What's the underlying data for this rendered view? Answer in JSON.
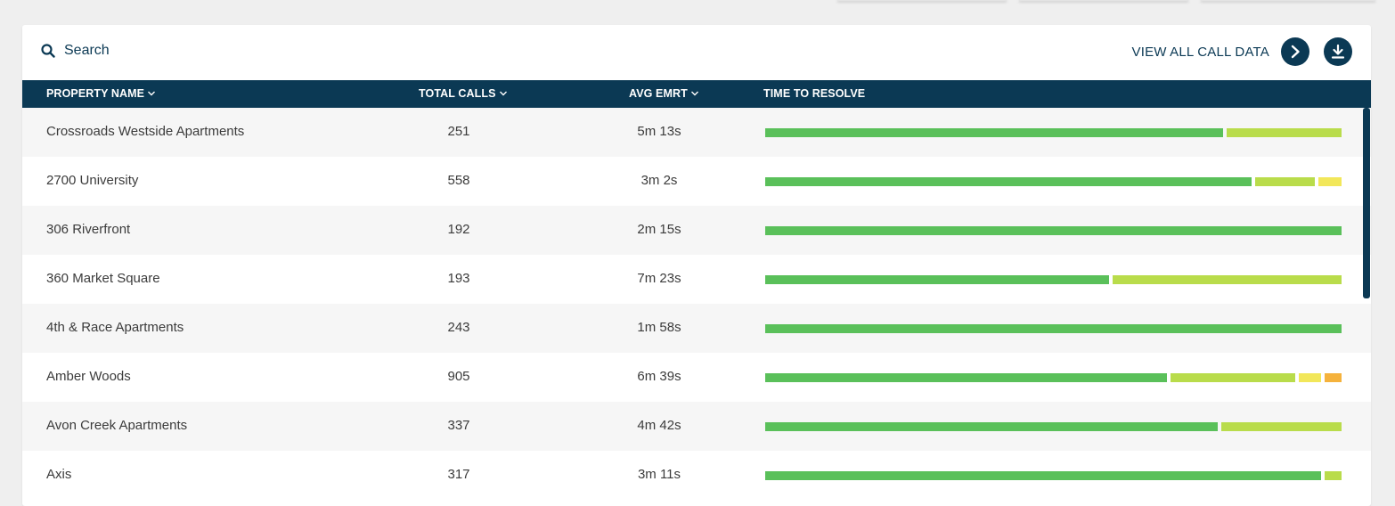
{
  "toolbar": {
    "search_label": "Search",
    "view_all_label": "VIEW ALL CALL DATA"
  },
  "table": {
    "columns": {
      "property_name": "PROPERTY NAME",
      "total_calls": "TOTAL CALLS",
      "avg_emrt": "AVG EMRT",
      "time_to_resolve": "TIME TO RESOLVE"
    },
    "rows": [
      {
        "name": "Crossroads Westside Apartments",
        "total_calls": "251",
        "avg_emrt": "5m 13s",
        "resolve": [
          {
            "color": "#5ac05a",
            "fraction": 0.8
          },
          {
            "color": "#b9dc4b",
            "fraction": 0.2
          }
        ]
      },
      {
        "name": "2700 University",
        "total_calls": "558",
        "avg_emrt": "3m 2s",
        "resolve": [
          {
            "color": "#5ac05a",
            "fraction": 0.855
          },
          {
            "color": "#b9dc4b",
            "fraction": 0.105
          },
          {
            "color": "#f2e75a",
            "fraction": 0.04
          }
        ]
      },
      {
        "name": "306 Riverfront",
        "total_calls": "192",
        "avg_emrt": "2m 15s",
        "resolve": [
          {
            "color": "#5ac05a",
            "fraction": 1.0
          }
        ]
      },
      {
        "name": "360 Market Square",
        "total_calls": "193",
        "avg_emrt": "7m 23s",
        "resolve": [
          {
            "color": "#5ac05a",
            "fraction": 0.6
          },
          {
            "color": "#b9dc4b",
            "fraction": 0.4
          }
        ]
      },
      {
        "name": "4th & Race Apartments",
        "total_calls": "243",
        "avg_emrt": "1m 58s",
        "resolve": [
          {
            "color": "#5ac05a",
            "fraction": 1.0
          }
        ]
      },
      {
        "name": "Amber Woods",
        "total_calls": "905",
        "avg_emrt": "6m 39s",
        "resolve": [
          {
            "color": "#5ac05a",
            "fraction": 0.71
          },
          {
            "color": "#b9dc4b",
            "fraction": 0.22
          },
          {
            "color": "#f2e75a",
            "fraction": 0.04
          },
          {
            "color": "#f5b23c",
            "fraction": 0.03
          }
        ]
      },
      {
        "name": "Avon Creek Apartments",
        "total_calls": "337",
        "avg_emrt": "4m 42s",
        "resolve": [
          {
            "color": "#5ac05a",
            "fraction": 0.79
          },
          {
            "color": "#b9dc4b",
            "fraction": 0.21
          }
        ]
      },
      {
        "name": "Axis",
        "total_calls": "317",
        "avg_emrt": "3m 11s",
        "resolve": [
          {
            "color": "#5ac05a",
            "fraction": 0.97
          },
          {
            "color": "#b9dc4b",
            "fraction": 0.03
          }
        ]
      }
    ]
  },
  "colors": {
    "navy": "#0b3954",
    "green": "#5ac05a",
    "lime": "#b9dc4b",
    "yellow": "#f2e75a",
    "orange": "#f5b23c"
  }
}
